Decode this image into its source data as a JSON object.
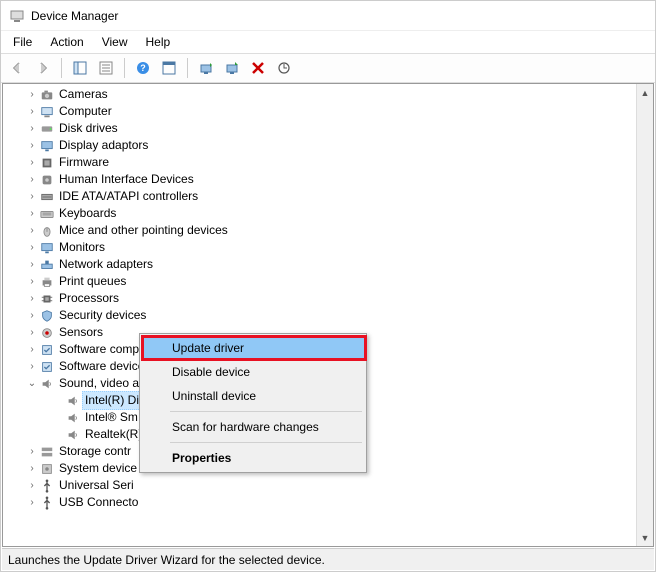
{
  "window": {
    "title": "Device Manager"
  },
  "menubar": [
    "File",
    "Action",
    "View",
    "Help"
  ],
  "tree": {
    "nodes": [
      {
        "label": "Cameras",
        "icon": "camera",
        "expanded": false
      },
      {
        "label": "Computer",
        "icon": "computer",
        "expanded": false
      },
      {
        "label": "Disk drives",
        "icon": "disk",
        "expanded": false
      },
      {
        "label": "Display adaptors",
        "icon": "display",
        "expanded": false
      },
      {
        "label": "Firmware",
        "icon": "firmware",
        "expanded": false
      },
      {
        "label": "Human Interface Devices",
        "icon": "hid",
        "expanded": false
      },
      {
        "label": "IDE ATA/ATAPI controllers",
        "icon": "ide",
        "expanded": false
      },
      {
        "label": "Keyboards",
        "icon": "keyboard",
        "expanded": false
      },
      {
        "label": "Mice and other pointing devices",
        "icon": "mouse",
        "expanded": false
      },
      {
        "label": "Monitors",
        "icon": "display",
        "expanded": false
      },
      {
        "label": "Network adapters",
        "icon": "network",
        "expanded": false
      },
      {
        "label": "Print queues",
        "icon": "printer",
        "expanded": false
      },
      {
        "label": "Processors",
        "icon": "cpu",
        "expanded": false
      },
      {
        "label": "Security devices",
        "icon": "security",
        "expanded": false
      },
      {
        "label": "Sensors",
        "icon": "sensor",
        "expanded": false
      },
      {
        "label": "Software components",
        "icon": "software",
        "expanded": false
      },
      {
        "label": "Software devices",
        "icon": "software",
        "expanded": false
      },
      {
        "label": "Sound, video and game controllers",
        "icon": "sound",
        "expanded": true,
        "children": [
          {
            "label": "Intel(R) Display Audio",
            "icon": "sound",
            "selected": true
          },
          {
            "label": "Intel® Sm",
            "icon": "sound"
          },
          {
            "label": "Realtek(R)",
            "icon": "sound"
          }
        ]
      },
      {
        "label": "Storage contr",
        "icon": "storage",
        "expanded": false
      },
      {
        "label": "System device",
        "icon": "system",
        "expanded": false
      },
      {
        "label": "Universal Seri",
        "icon": "usb",
        "expanded": false
      },
      {
        "label": "USB Connecto",
        "icon": "usb",
        "expanded": false
      }
    ]
  },
  "context_menu": {
    "items": [
      {
        "label": "Update driver",
        "highlighted": true
      },
      {
        "label": "Disable device"
      },
      {
        "label": "Uninstall device"
      },
      {
        "sep": true
      },
      {
        "label": "Scan for hardware changes"
      },
      {
        "sep": true
      },
      {
        "label": "Properties",
        "bold": true
      }
    ]
  },
  "statusbar": "Launches the Update Driver Wizard for the selected device."
}
